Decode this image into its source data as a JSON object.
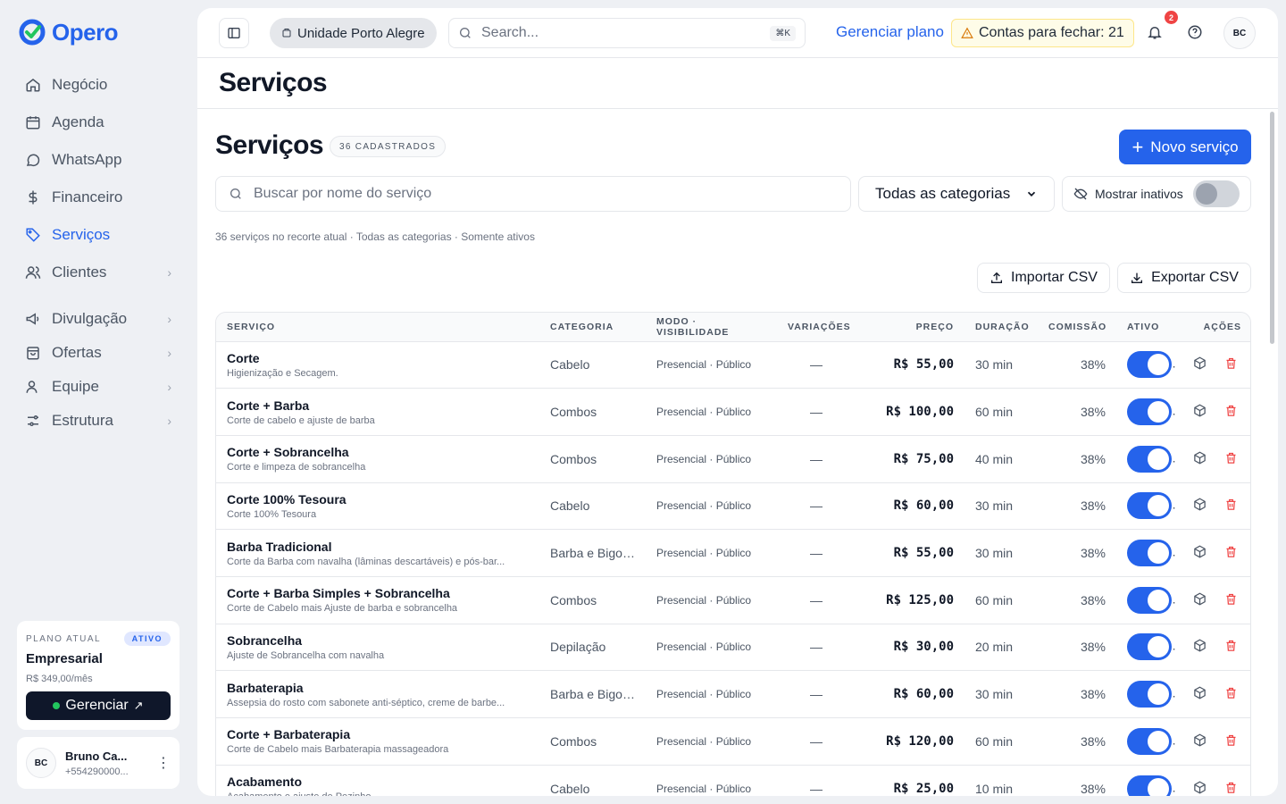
{
  "brand": {
    "name": "Opero",
    "colors": {
      "primary": "#2563eb",
      "danger": "#ef4444",
      "dark": "#0f172a",
      "success": "#22c55e"
    }
  },
  "sidebar": {
    "items": [
      {
        "label": "Negócio",
        "icon": "home-icon"
      },
      {
        "label": "Agenda",
        "icon": "calendar-icon"
      },
      {
        "label": "WhatsApp",
        "icon": "chat-bubble-icon"
      },
      {
        "label": "Financeiro",
        "icon": "dollar-icon"
      },
      {
        "label": "Serviços",
        "icon": "tag-icon",
        "active": true
      },
      {
        "label": "Clientes",
        "icon": "users-icon"
      },
      {
        "label": "Divulgação",
        "icon": "megaphone-icon"
      },
      {
        "label": "Ofertas",
        "icon": "shopping-bag-icon"
      },
      {
        "label": "Equipe",
        "icon": "team-icon"
      },
      {
        "label": "Estrutura",
        "icon": "settings-sliders-icon"
      }
    ],
    "plan": {
      "label": "PLANO ATUAL",
      "badge": "ATIVO",
      "name": "Empresarial",
      "price": "R$ 349,00/mês",
      "manage": "Gerenciar"
    },
    "user": {
      "initials": "BC",
      "name": "Bruno Ca...",
      "phone": "+554290000..."
    }
  },
  "topbar": {
    "unit": "Unidade Porto Alegre",
    "search_placeholder": "Search...",
    "shortcut": "⌘K",
    "manage_plan": "Gerenciar plano",
    "accounts": "Contas para fechar: 21",
    "notifications": "2",
    "avatar": "BC"
  },
  "page": {
    "title": "Serviços",
    "section_title": "Serviços",
    "count_badge": "36 CADASTRADOS",
    "new_button": "Novo serviço",
    "search_placeholder": "Buscar por nome do serviço",
    "category_select": "Todas as categorias",
    "show_inactive": "Mostrar inativos",
    "summary": "36 serviços no recorte atual · Todas as categorias · Somente ativos",
    "import": "Importar CSV",
    "export": "Exportar CSV"
  },
  "table": {
    "headers": [
      "SERVIÇO",
      "CATEGORIA",
      "MODO · VISIBILIDADE",
      "VARIAÇÕES",
      "PREÇO",
      "DURAÇÃO",
      "COMISSÃO",
      "ATIVO",
      "AÇÕES"
    ],
    "rows": [
      {
        "name": "Corte",
        "desc": "Higienização e Secagem.",
        "category": "Cabelo",
        "mode": "Presencial · Público",
        "variations": "—",
        "price": "R$ 55,00",
        "duration": "30 min",
        "commission": "38%",
        "active": true
      },
      {
        "name": "Corte + Barba",
        "desc": "Corte de cabelo e ajuste de barba",
        "category": "Combos",
        "mode": "Presencial · Público",
        "variations": "—",
        "price": "R$ 100,00",
        "duration": "60 min",
        "commission": "38%",
        "active": true
      },
      {
        "name": "Corte + Sobrancelha",
        "desc": "Corte e limpeza de sobrancelha",
        "category": "Combos",
        "mode": "Presencial · Público",
        "variations": "—",
        "price": "R$ 75,00",
        "duration": "40 min",
        "commission": "38%",
        "active": true
      },
      {
        "name": "Corte 100% Tesoura",
        "desc": "Corte 100% Tesoura",
        "category": "Cabelo",
        "mode": "Presencial · Público",
        "variations": "—",
        "price": "R$ 60,00",
        "duration": "30 min",
        "commission": "38%",
        "active": true
      },
      {
        "name": "Barba Tradicional",
        "desc": "Corte da Barba com navalha (lâminas descartáveis) e pós-bar...",
        "category": "Barba e Bigode",
        "mode": "Presencial · Público",
        "variations": "—",
        "price": "R$ 55,00",
        "duration": "30 min",
        "commission": "38%",
        "active": true
      },
      {
        "name": "Corte + Barba Simples + Sobrancelha",
        "desc": "Corte de Cabelo mais Ajuste de barba e sobrancelha",
        "category": "Combos",
        "mode": "Presencial · Público",
        "variations": "—",
        "price": "R$ 125,00",
        "duration": "60 min",
        "commission": "38%",
        "active": true
      },
      {
        "name": "Sobrancelha",
        "desc": "Ajuste de Sobrancelha com navalha",
        "category": "Depilação",
        "mode": "Presencial · Público",
        "variations": "—",
        "price": "R$ 30,00",
        "duration": "20 min",
        "commission": "38%",
        "active": true
      },
      {
        "name": "Barbaterapia",
        "desc": "Assepsia do rosto com sabonete anti-séptico, creme de barbe...",
        "category": "Barba e Bigode",
        "mode": "Presencial · Público",
        "variations": "—",
        "price": "R$ 60,00",
        "duration": "30 min",
        "commission": "38%",
        "active": true
      },
      {
        "name": "Corte + Barbaterapia",
        "desc": "Corte de Cabelo mais Barbaterapia massageadora",
        "category": "Combos",
        "mode": "Presencial · Público",
        "variations": "—",
        "price": "R$ 120,00",
        "duration": "60 min",
        "commission": "38%",
        "active": true
      },
      {
        "name": "Acabamento",
        "desc": "Acabamento e ajuste de Pezinho",
        "category": "Cabelo",
        "mode": "Presencial · Público",
        "variations": "—",
        "price": "R$ 25,00",
        "duration": "10 min",
        "commission": "38%",
        "active": true
      }
    ]
  }
}
